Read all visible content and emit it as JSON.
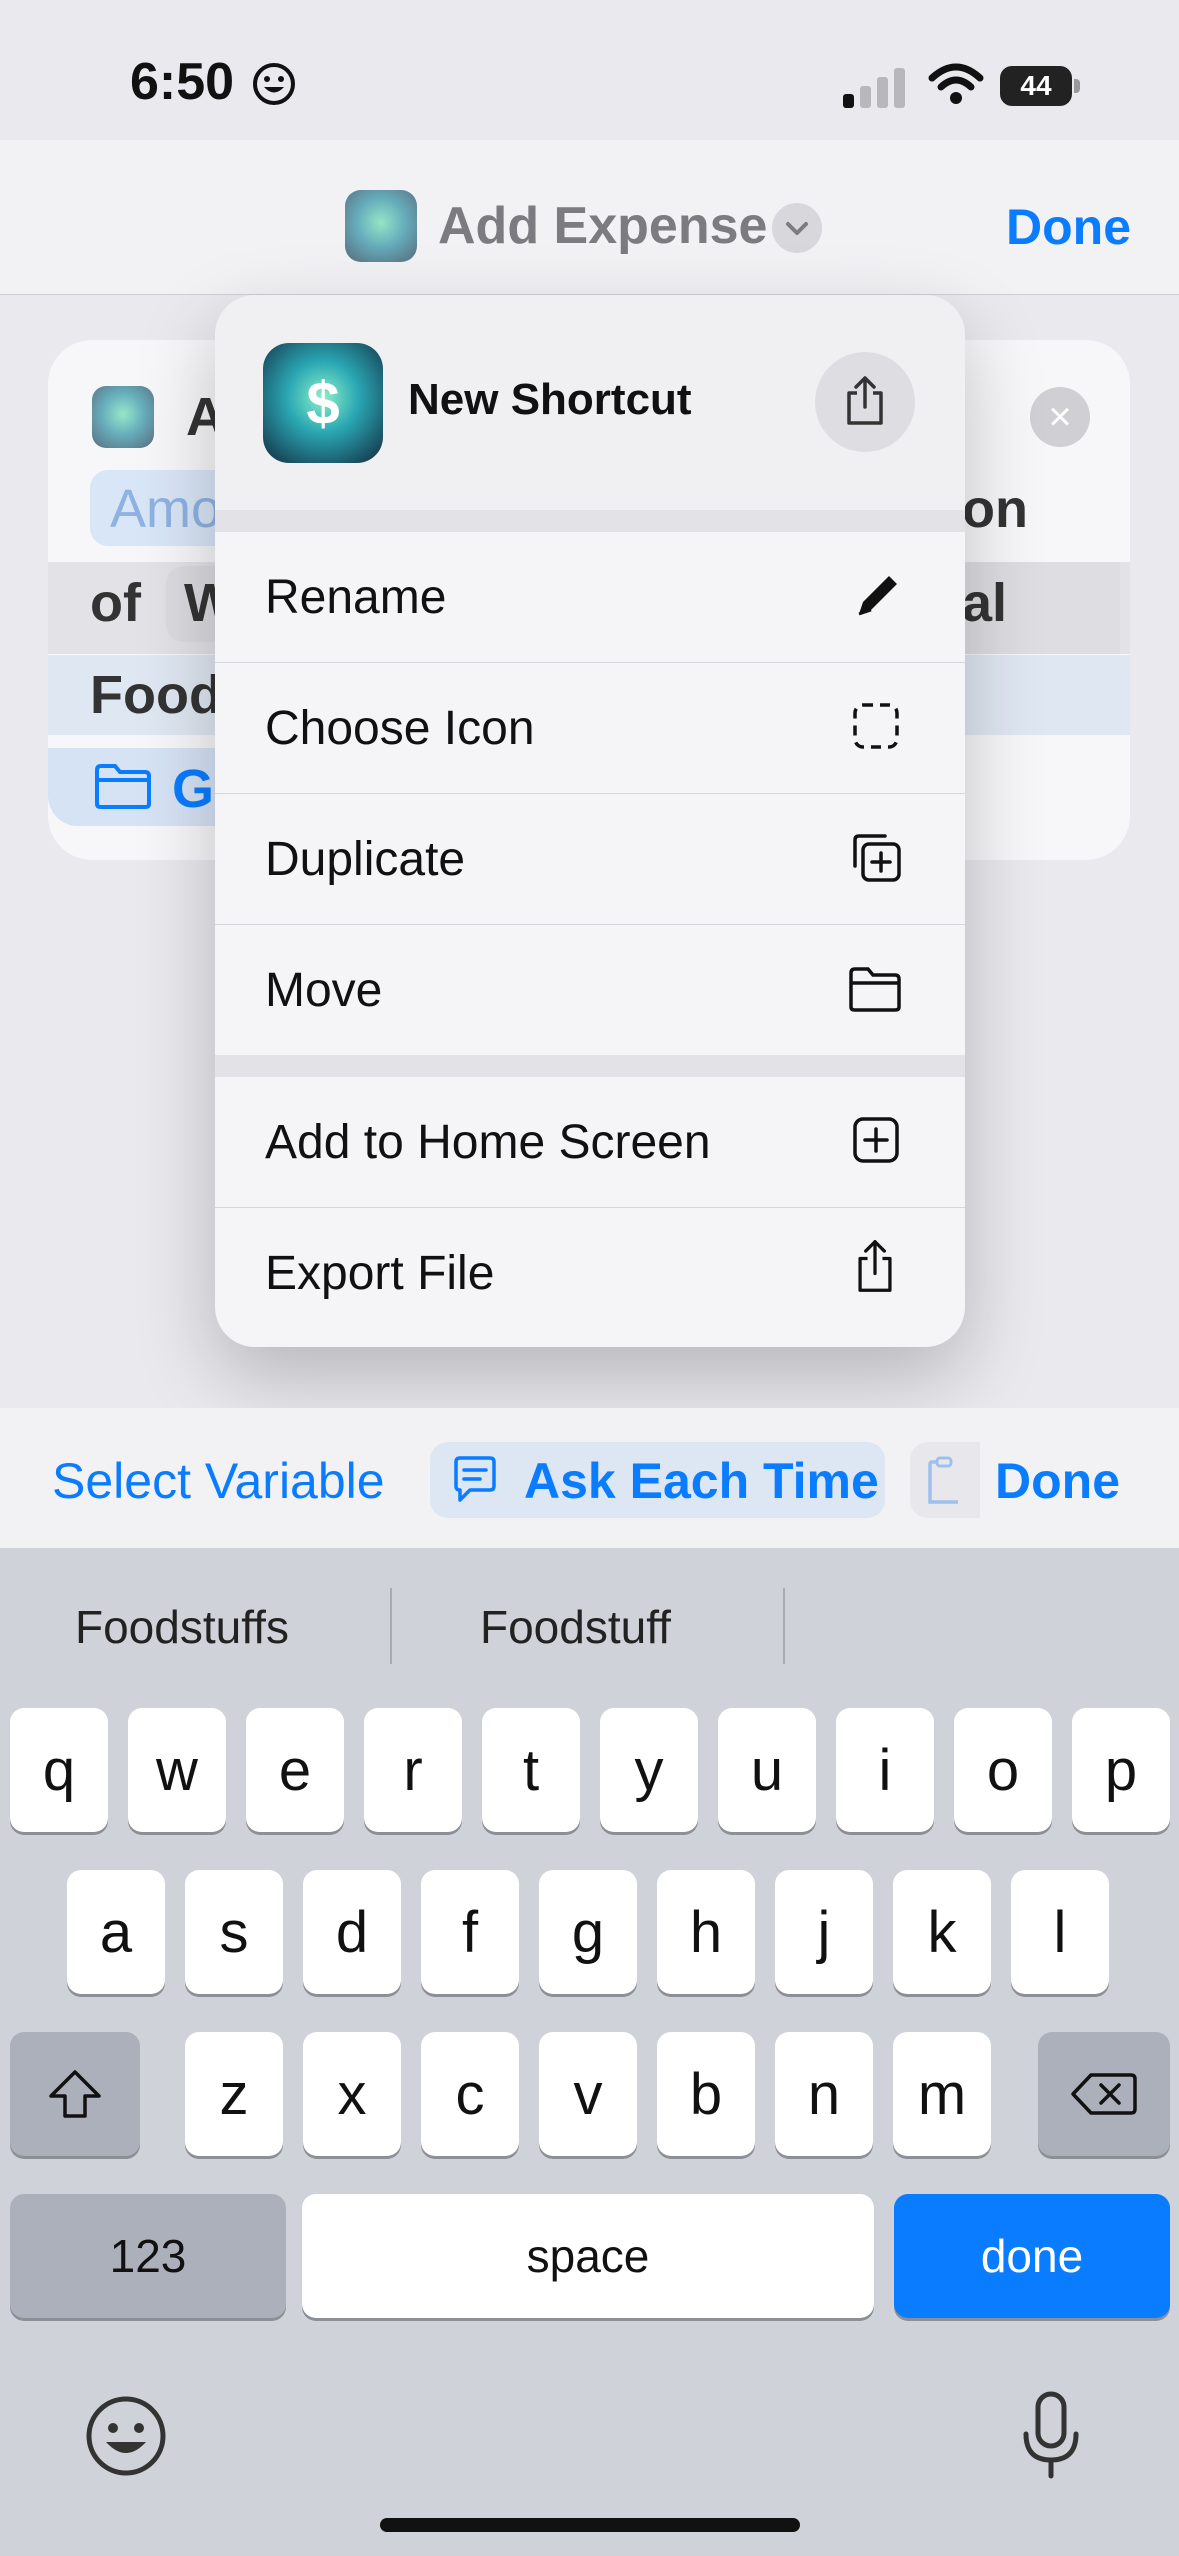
{
  "status_bar": {
    "time": "6:50",
    "battery": "44"
  },
  "nav": {
    "title": "Add Expense",
    "done_label": "Done"
  },
  "background_card": {
    "title_fragment": "A",
    "token_amount_fragment": "Amo",
    "text_on_fragment": "on",
    "text_of": "of",
    "token_w_fragment": "W",
    "text_al_fragment": "al",
    "text_food_fragment": "Food",
    "folder_text_fragment": "G"
  },
  "menu": {
    "title": "New Shortcut",
    "items": [
      {
        "label": "Rename",
        "icon": "pencil-icon"
      },
      {
        "label": "Choose Icon",
        "icon": "dashed-square-icon"
      },
      {
        "label": "Duplicate",
        "icon": "duplicate-icon"
      },
      {
        "label": "Move",
        "icon": "folder-icon"
      },
      {
        "label": "Add to Home Screen",
        "icon": "plus-square-icon"
      },
      {
        "label": "Export File",
        "icon": "share-icon"
      }
    ]
  },
  "toolbar": {
    "select_variable": "Select Variable",
    "ask_each_time": "Ask Each Time",
    "done": "Done"
  },
  "keyboard": {
    "suggestions": [
      "Foodstuffs",
      "Foodstuff"
    ],
    "row1": [
      "q",
      "w",
      "e",
      "r",
      "t",
      "y",
      "u",
      "i",
      "o",
      "p"
    ],
    "row2": [
      "a",
      "s",
      "d",
      "f",
      "g",
      "h",
      "j",
      "k",
      "l"
    ],
    "row3": [
      "z",
      "x",
      "c",
      "v",
      "b",
      "n",
      "m"
    ],
    "numbers_key": "123",
    "space_key": "space",
    "done_key": "done"
  },
  "colors": {
    "accent": "#0a7cff",
    "keyboard_bg": "#d0d2d9"
  }
}
